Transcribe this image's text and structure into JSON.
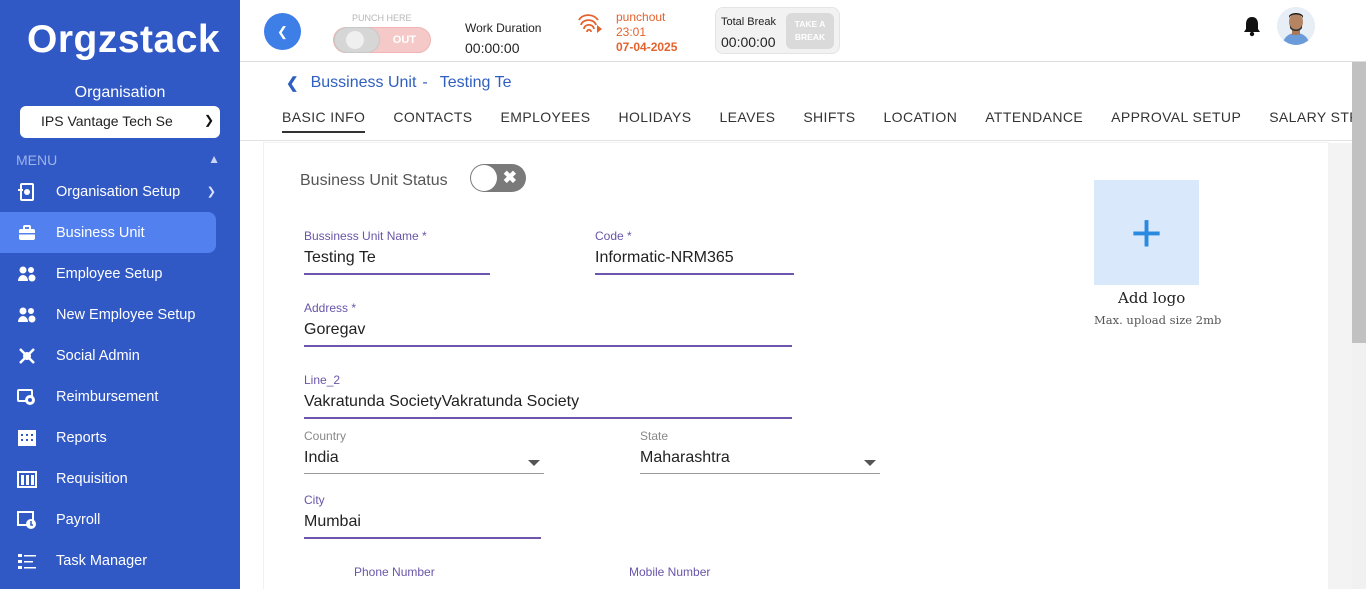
{
  "sidebar": {
    "logo": "Orgzstack",
    "org_label": "Organisation",
    "org_select": "IPS Vantage Tech Se",
    "menu_label": "MENU",
    "items": [
      {
        "label": "Organisation Setup",
        "icon": "org-setup-icon"
      },
      {
        "label": "Business Unit",
        "icon": "briefcase-icon"
      },
      {
        "label": "Employee Setup",
        "icon": "employee-setup-icon"
      },
      {
        "label": "New Employee Setup",
        "icon": "new-employee-setup-icon"
      },
      {
        "label": "Social Admin",
        "icon": "social-admin-icon"
      },
      {
        "label": "Reimbursement",
        "icon": "reimbursement-icon"
      },
      {
        "label": "Reports",
        "icon": "reports-icon"
      },
      {
        "label": "Requisition",
        "icon": "requisition-icon"
      },
      {
        "label": "Payroll",
        "icon": "payroll-icon"
      },
      {
        "label": "Task Manager",
        "icon": "task-manager-icon"
      }
    ],
    "colors": {
      "bg": "#3159c6",
      "active": "#5380ef"
    }
  },
  "topbar": {
    "punch_here": "PUNCH HERE",
    "punch_toggle": "OUT",
    "work_label": "Work Duration",
    "work_value": "00:00:00",
    "punchout_label": "punchout",
    "punchout_time": "23:01",
    "punchout_date": "07-04-2025",
    "break_label": "Total Break",
    "break_value": "00:00:00",
    "take_break_1": "TAKE A",
    "take_break_2": "BREAK"
  },
  "breadcrumb": {
    "first": "Bussiness Unit",
    "sep": "-",
    "second": "Testing Te"
  },
  "tabs": [
    "BASIC INFO",
    "CONTACTS",
    "EMPLOYEES",
    "HOLIDAYS",
    "LEAVES",
    "SHIFTS",
    "LOCATION",
    "ATTENDANCE",
    "APPROVAL SETUP",
    "SALARY STRUCTURE"
  ],
  "form": {
    "status_label": "Business Unit Status",
    "bu_name_label": "Bussiness Unit Name *",
    "bu_name_value": "Testing Te",
    "code_label": "Code *",
    "code_value": "Informatic-NRM365",
    "address_label": "Address *",
    "address_value": "Goregav",
    "line2_label": "Line_2",
    "line2_value": "Vakratunda SocietyVakratunda Society",
    "country_label": "Country",
    "country_value": "India",
    "state_label": "State",
    "state_value": "Maharashtra",
    "city_label": "City",
    "city_value": "Mumbai",
    "phone_label": "Phone Number",
    "mobile_label": "Mobile Number"
  },
  "logo_upload": {
    "title": "Add logo",
    "hint": "Max. upload size 2mb"
  }
}
